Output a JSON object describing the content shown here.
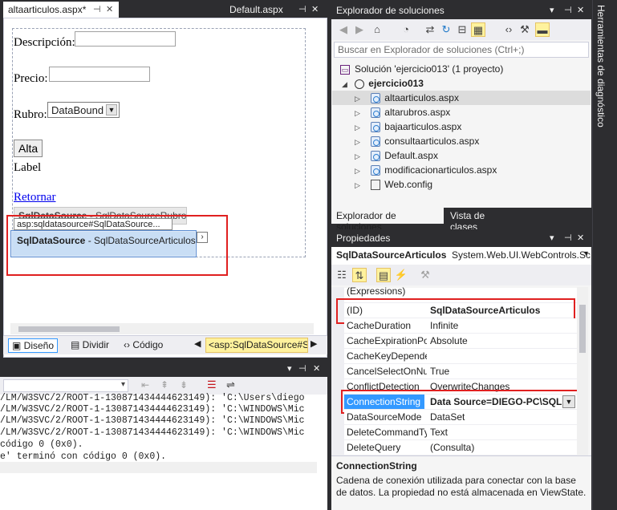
{
  "editor": {
    "active_tab": "altaarticulos.aspx*",
    "inactive_tab": "Default.aspx",
    "form": {
      "descripcion_label": "Descripción:",
      "precio_label": "Precio:",
      "rubro_label": "Rubro:",
      "dropdown_value": "DataBound",
      "alta_button": "Alta",
      "label_text": "Label",
      "link_text": "Retornar",
      "sds_rubros_bold": "SqlDataSource",
      "sds_rubros_rest": " - SqlDataSourceRubros",
      "tag_tooltip": "asp:sqldatasource#SqlDataSource...",
      "sds_articulos_bold": "SqlDataSource",
      "sds_articulos_rest": " - SqlDataSourceArticulos"
    },
    "views": {
      "design": "Diseño",
      "split": "Dividir",
      "source": "Código",
      "tag_crumb": "<asp:SqlDataSource#Sc"
    }
  },
  "output": {
    "lines": [
      "/LM/W3SVC/2/ROOT-1-130871434444623149): 'C:\\Users\\diego",
      "/LM/W3SVC/2/ROOT-1-130871434444623149): 'C:\\WINDOWS\\Mic",
      "/LM/W3SVC/2/ROOT-1-130871434444623149): 'C:\\WINDOWS\\Mic",
      "/LM/W3SVC/2/ROOT-1-130871434444623149): 'C:\\WINDOWS\\Mic",
      "código 0 (0x0).",
      "e' terminó con código 0 (0x0)."
    ]
  },
  "solution_explorer": {
    "title": "Explorador de soluciones",
    "search_placeholder": "Buscar en Explorador de soluciones (Ctrl+;)",
    "solution_label": "Solución 'ejercicio013'  (1 proyecto)",
    "project_label": "ejercicio013",
    "files": [
      "altaarticulos.aspx",
      "altarubros.aspx",
      "bajaarticulos.aspx",
      "consultaarticulos.aspx",
      "Default.aspx",
      "modificacionarticulos.aspx",
      "Web.config"
    ],
    "bottom_tabs": [
      "Explorador de soluciones",
      "Vista de clases"
    ]
  },
  "properties": {
    "title": "Propiedades",
    "object_name": "SqlDataSourceArticulos",
    "object_type": "System.Web.UI.WebControls.Sc",
    "rows": [
      {
        "name": "(Expressions)",
        "value": ""
      },
      {
        "name": "(ID)",
        "value": "SqlDataSourceArticulos"
      },
      {
        "name": "CacheDuration",
        "value": "Infinite"
      },
      {
        "name": "CacheExpirationPo",
        "value": "Absolute"
      },
      {
        "name": "CacheKeyDepende",
        "value": ""
      },
      {
        "name": "CancelSelectOnNu",
        "value": "True"
      },
      {
        "name": "ConflictDetection",
        "value": "OverwriteChanges"
      },
      {
        "name": "ConnectionString",
        "value": "Data Source=DIEGO-PC\\SQLE"
      },
      {
        "name": "DataSourceMode",
        "value": "DataSet"
      },
      {
        "name": "DeleteCommandTy",
        "value": "Text"
      },
      {
        "name": "DeleteQuery",
        "value": "(Consulta)"
      }
    ],
    "desc_title": "ConnectionString",
    "desc_text": "Cadena de conexión utilizada para conectar con la base de datos. La propiedad no está almacenada en ViewState."
  },
  "side_panel": {
    "label": "Herramientas de diagnóstico"
  }
}
